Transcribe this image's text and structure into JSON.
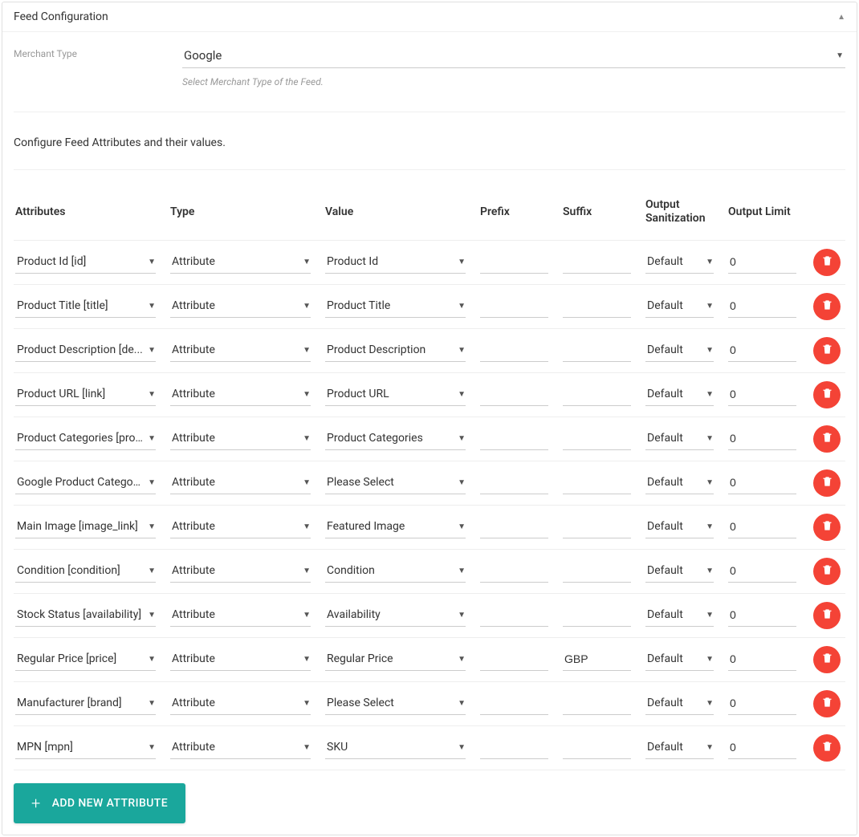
{
  "panel_title": "Feed Configuration",
  "merchant": {
    "label": "Merchant Type",
    "value": "Google",
    "hint": "Select Merchant Type of the Feed."
  },
  "config_text": "Configure Feed Attributes and their values.",
  "headers": {
    "attributes": "Attributes",
    "type": "Type",
    "value": "Value",
    "prefix": "Prefix",
    "suffix": "Suffix",
    "sanitization": "Output Sanitization",
    "limit": "Output Limit"
  },
  "rows": [
    {
      "attribute": "Product Id [id]",
      "type": "Attribute",
      "value": "Product Id",
      "prefix": "",
      "suffix": "",
      "sanitization": "Default",
      "limit": "0"
    },
    {
      "attribute": "Product Title [title]",
      "type": "Attribute",
      "value": "Product Title",
      "prefix": "",
      "suffix": "",
      "sanitization": "Default",
      "limit": "0"
    },
    {
      "attribute": "Product Description [description]",
      "attribute_display": "Product Description [de...",
      "type": "Attribute",
      "value": "Product Description",
      "prefix": "",
      "suffix": "",
      "sanitization": "Default",
      "limit": "0"
    },
    {
      "attribute": "Product URL [link]",
      "type": "Attribute",
      "value": "Product URL",
      "prefix": "",
      "suffix": "",
      "sanitization": "Default",
      "limit": "0"
    },
    {
      "attribute": "Product Categories [product_type]",
      "attribute_display": "Product Categories [pro...",
      "type": "Attribute",
      "value": "Product Categories",
      "prefix": "",
      "suffix": "",
      "sanitization": "Default",
      "limit": "0"
    },
    {
      "attribute": "Google Product Category",
      "attribute_display": "Google Product Categor...",
      "type": "Attribute",
      "value": "Please Select",
      "prefix": "",
      "suffix": "",
      "sanitization": "Default",
      "limit": "0"
    },
    {
      "attribute": "Main Image [image_link]",
      "type": "Attribute",
      "value": "Featured Image",
      "prefix": "",
      "suffix": "",
      "sanitization": "Default",
      "limit": "0"
    },
    {
      "attribute": "Condition [condition]",
      "type": "Attribute",
      "value": "Condition",
      "prefix": "",
      "suffix": "",
      "sanitization": "Default",
      "limit": "0"
    },
    {
      "attribute": "Stock Status [availability]",
      "type": "Attribute",
      "value": "Availability",
      "prefix": "",
      "suffix": "",
      "sanitization": "Default",
      "limit": "0"
    },
    {
      "attribute": "Regular Price [price]",
      "type": "Attribute",
      "value": "Regular Price",
      "prefix": "",
      "suffix": "GBP",
      "sanitization": "Default",
      "limit": "0"
    },
    {
      "attribute": "Manufacturer [brand]",
      "type": "Attribute",
      "value": "Please Select",
      "prefix": "",
      "suffix": "",
      "sanitization": "Default",
      "limit": "0"
    },
    {
      "attribute": "MPN [mpn]",
      "type": "Attribute",
      "value": "SKU",
      "prefix": "",
      "suffix": "",
      "sanitization": "Default",
      "limit": "0"
    }
  ],
  "add_button": "ADD NEW ATTRIBUTE"
}
